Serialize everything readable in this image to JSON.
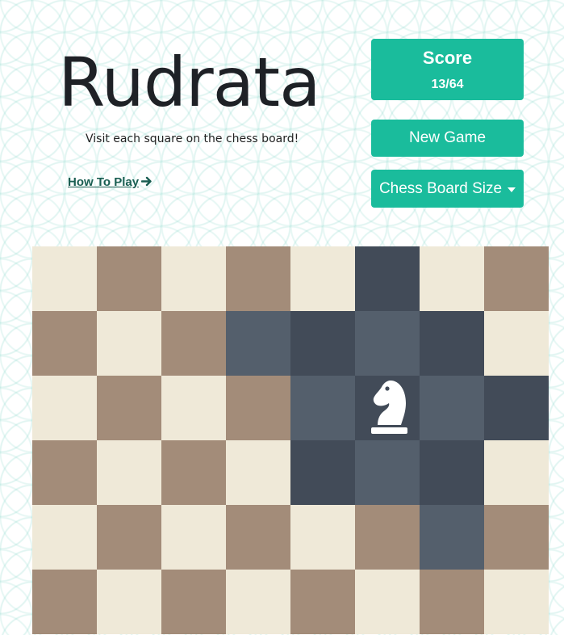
{
  "header": {
    "title": "Rudrata",
    "tagline": "Visit each square on the chess board!",
    "how_to_play": "How To Play"
  },
  "score": {
    "label": "Score",
    "value": "13/64"
  },
  "buttons": {
    "new_game": "New Game",
    "board_size": "Chess Board Size"
  },
  "board": {
    "size": 8,
    "visible_rows": 6,
    "knight": {
      "row": 2,
      "col": 5
    },
    "visited": [
      [
        0,
        5
      ],
      [
        1,
        4
      ],
      [
        1,
        6
      ],
      [
        2,
        7
      ],
      [
        3,
        4
      ],
      [
        3,
        6
      ]
    ],
    "available_moves": [
      [
        1,
        3
      ],
      [
        1,
        5
      ],
      [
        2,
        4
      ],
      [
        2,
        6
      ],
      [
        3,
        5
      ],
      [
        4,
        6
      ]
    ]
  },
  "colors": {
    "accent": "#1abc9c",
    "light_square": "#efe9d8",
    "dark_square": "#a38c79",
    "visited_square": "#424b58",
    "available_square": "#545f6c",
    "title_text": "#1e2126",
    "link_text": "#1a5e52"
  },
  "icons": {
    "knight": "chess-knight-icon",
    "how_to_play_arrow": "arrow-right-icon",
    "dropdown": "caret-down-icon"
  }
}
